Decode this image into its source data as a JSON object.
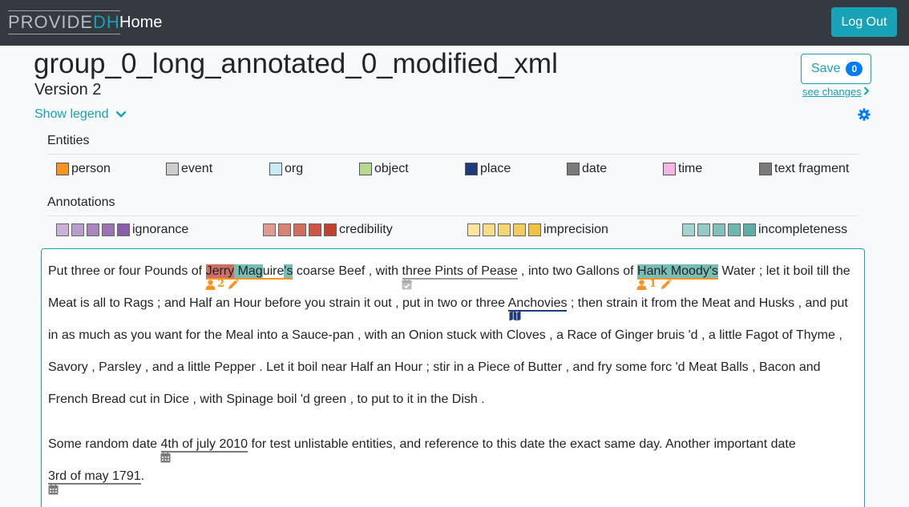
{
  "navbar": {
    "brand_part1": "PROVIDE",
    "brand_part2": "DH",
    "home": "Home",
    "logout": "Log Out"
  },
  "header": {
    "title": "group_0_long_annotated_0_modified_xml",
    "version": "Version 2",
    "save_label": "Save",
    "save_count": "0",
    "see_changes": "see changes",
    "show_legend": "Show legend"
  },
  "legend": {
    "entities_title": "Entities",
    "entities": [
      {
        "label": "person",
        "color": "#f7931e"
      },
      {
        "label": "event",
        "color": "#cccccc"
      },
      {
        "label": "org",
        "color": "#c8ecf7"
      },
      {
        "label": "object",
        "color": "#b7d98f"
      },
      {
        "label": "place",
        "color": "#1f3a7a"
      },
      {
        "label": "date",
        "color": "#7a7a7a"
      },
      {
        "label": "time",
        "color": "#f2b6e0"
      },
      {
        "label": "text fragment",
        "color": "#7a7a7a"
      }
    ],
    "annotations_title": "Annotations",
    "annotations": [
      {
        "label": "ignorance",
        "colors": [
          "#c9b2d6",
          "#b99dc9",
          "#a985bd",
          "#9b72b2",
          "#8a5ea6"
        ]
      },
      {
        "label": "credibility",
        "colors": [
          "#e09b8f",
          "#d98375",
          "#d26c5c",
          "#cb5645",
          "#c3402e"
        ]
      },
      {
        "label": "imprecision",
        "colors": [
          "#fbe49e",
          "#f8dc87",
          "#f5d472",
          "#f2cc5c",
          "#efc446"
        ]
      },
      {
        "label": "incompleteness",
        "colors": [
          "#a7d3cf",
          "#94cac5",
          "#82c0bb",
          "#70b7b1",
          "#5eada7"
        ]
      }
    ]
  },
  "text": {
    "l1": {
      "a": "Put three or four Pounds of ",
      "b1": "Jerry",
      "b2": " Mag",
      "b3": "uire",
      "b4": "'s",
      "c": " coarse Beef , with ",
      "d": "three Pints of Pease",
      "e": " , into two Gallons of ",
      "f": "Hank Moody's",
      "g": " Water ; let it boil till the"
    },
    "l2": {
      "a": "Meat is all to Rags ; and Half an Hour before you strain it out , put in two or three ",
      "b": "Anchovies",
      "c": " ; then strain it from the Meat and Husks , and put"
    },
    "l3": "in as much as you want for the Meal into a Sauce-pan , with an Onion stuck with Cloves , a Race of Ginger bruis 'd , a little Fagot of Thyme ,",
    "l4": "Savory , Parsley , and a little Pepper . Let it boil near Half an Hour ; stir in a Piece of Butter , and fry some forc 'd Meat Balls , Bacon and",
    "l5": "French Bread cut in Dice , with Spinage boil 'd green , to put to it in the Dish .",
    "l6": {
      "a": "Some random date ",
      "b": "4th of july 2010",
      "c": " for test unlistable entities, and reference to this date the exact same day. Another important date"
    },
    "l7": {
      "a": "3rd of may 1791",
      "b": "."
    },
    "count_jerry": "2",
    "count_hank": "1"
  },
  "icons": {
    "person_mark": "user-icon",
    "edit_mark": "pencil-icon",
    "event_mark": "calendar-check-icon",
    "place_mark": "map-icon",
    "date_mark": "calendar-icon",
    "settings": "gear-icon",
    "chevron": "chevron-down-icon"
  }
}
